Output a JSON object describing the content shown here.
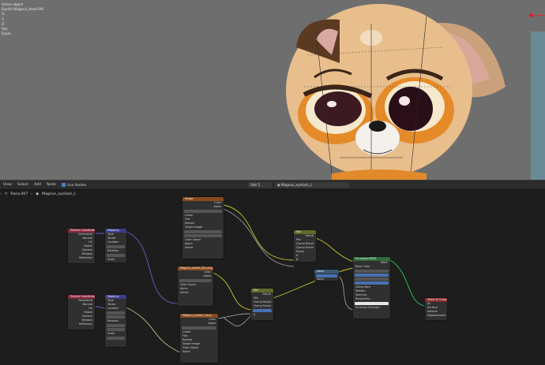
{
  "viewport": {
    "info_lines": [
      "Active object",
      "Eyelid (Magnus_Head.00)",
      "X:",
      "Y:",
      "Z:",
      "Rot:",
      "Scale:"
    ]
  },
  "header": {
    "menus": [
      "View",
      "Select",
      "Add",
      "Node"
    ],
    "use_nodes_label": "Use Nodes",
    "slot_label": "Slot 5",
    "material_name": "Magnus_eyelash_L"
  },
  "breadcrumb": [
    "Rana.007",
    "Magnus_eyelash_L"
  ],
  "nodes": {
    "texcoord1": {
      "title": "Texture Coordinate",
      "rows": [
        "Generated",
        "Normal",
        "UV",
        "Object",
        "Camera",
        "Window",
        "Reflection"
      ]
    },
    "mapping1": {
      "title": "Mapping",
      "rows": [
        "Type",
        "Vector",
        "Location",
        "Rotation",
        "Scale"
      ]
    },
    "texcoord2": {
      "title": "Texture Coordinate",
      "rows": [
        "Generated",
        "Normal",
        "UV",
        "Object",
        "Camera",
        "Window",
        "Reflection"
      ]
    },
    "mapping2": {
      "title": "Mapping",
      "rows": [
        "Type",
        "Vector",
        "Location",
        "Rotation",
        "Scale"
      ]
    },
    "image_top": {
      "title": "Image",
      "rows": [
        "Color",
        "Alpha",
        "Linear",
        "Flat",
        "Repeat",
        "Single Image",
        "Color Space",
        "Alpha",
        "Vector"
      ]
    },
    "image_mid": {
      "title": "Magnus_eyelid_001.png",
      "rows": [
        "Color",
        "Alpha",
        "Color Space",
        "Alpha",
        "Vector"
      ]
    },
    "image_bot": {
      "title": "Magnus_eyelid_C.png",
      "rows": [
        "Color",
        "Alpha",
        "Linear",
        "Flat",
        "Repeat",
        "Single Image",
        "Color Space",
        "Alpha",
        "Vector"
      ]
    },
    "mix_top": {
      "title": "Mix",
      "rows": [
        "Result",
        "Mix",
        "Clamp Result",
        "Clamp Factor",
        "Factor",
        "A",
        "B"
      ]
    },
    "mix_mid": {
      "title": "Mix",
      "rows": [
        "Result",
        "Mix",
        "Clamp Result",
        "Clamp Factor",
        "Factor",
        "A",
        "B"
      ]
    },
    "value_node": {
      "title": "Value",
      "rows": [
        "Value",
        "Value"
      ]
    },
    "principled": {
      "title": "Principled BSDF",
      "rows": [
        "BSDF",
        "Base Color",
        "Subsurface",
        "Metallic",
        "Specular",
        "Roughness",
        "IOR",
        "Alpha",
        "Normal",
        "Clearcoat",
        "Transmission",
        "Emission",
        "Emission Strength",
        "Alpha"
      ]
    },
    "output": {
      "title": "Material Output",
      "rows": [
        "All",
        "Surface",
        "Volume",
        "Displacement"
      ]
    }
  }
}
